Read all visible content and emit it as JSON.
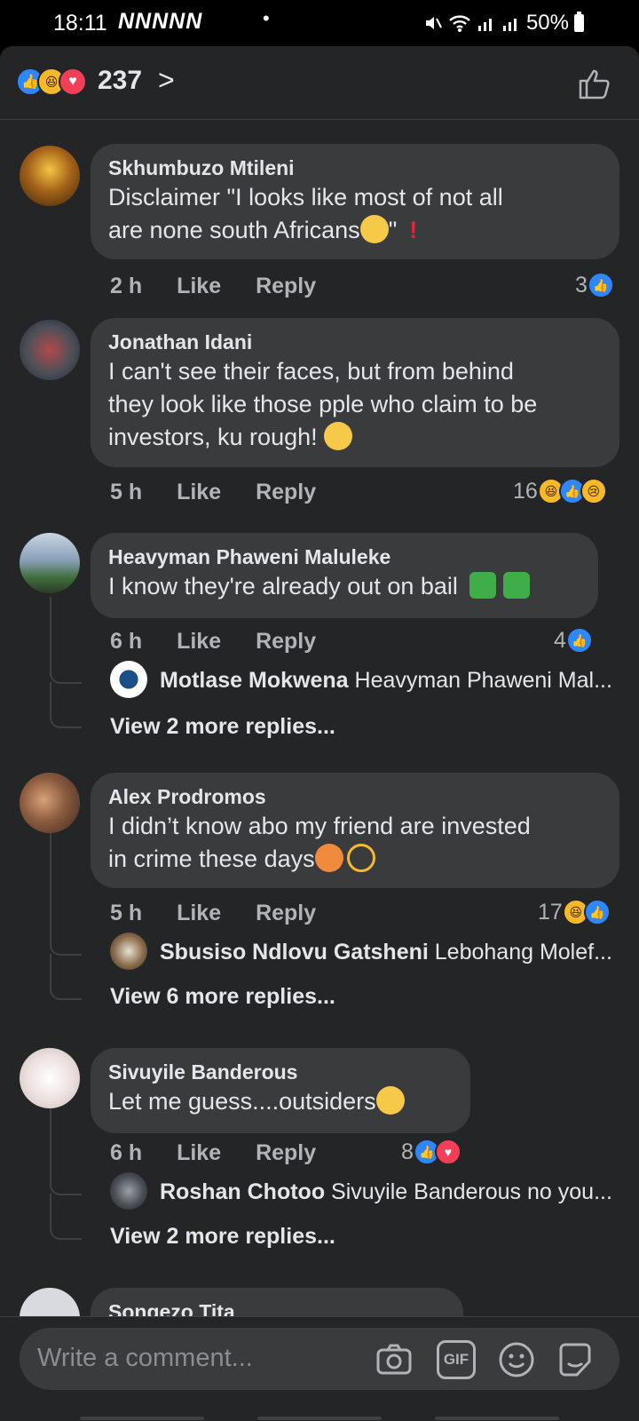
{
  "status_bar": {
    "time": "18:11",
    "notifications": "NNNNN",
    "dot": "•",
    "battery": "50%"
  },
  "header": {
    "reaction_count": "237",
    "reaction_icons": [
      "like-icon",
      "haha-icon",
      "love-icon"
    ]
  },
  "comments": [
    {
      "name": "Skhumbuzo Mtileni",
      "text_line1": "Disclaimer \"I looks like most of not all",
      "text_line2": "are  none south Africans",
      "text_tail": "\"",
      "emoji": "eye-roll-emoji",
      "time": "2 h",
      "like": "Like",
      "reply": "Reply",
      "reaction_count": "3",
      "reactions": [
        "like"
      ]
    },
    {
      "name": "Jonathan Idani",
      "text_line1": "I can't see their faces, but from behind",
      "text_line2": "they look like those pple who claim to be",
      "text_line3": "investors, ku rough!",
      "emoji": "crying-laughing-emoji",
      "time": "5 h",
      "like": "Like",
      "reply": "Reply",
      "reaction_count": "16",
      "reactions": [
        "haha",
        "like",
        "sad"
      ]
    },
    {
      "name": "Heavyman Phaweni Maluleke",
      "text_line1": "I know they're already out on bail",
      "time": "6 h",
      "like": "Like",
      "reply": "Reply",
      "reaction_count": "4",
      "reactions": [
        "like"
      ],
      "reply_preview": {
        "name": "Motlase Mokwena",
        "text": "Heavyman Phaweni Mal..."
      },
      "more_replies": "View 2 more replies..."
    },
    {
      "name": "Alex Prodromos",
      "text_line1": "I didn’t know abo my friend are invested",
      "text_line2": "in crime these days",
      "time": "5 h",
      "like": "Like",
      "reply": "Reply",
      "reaction_count": "17",
      "reactions": [
        "haha",
        "like"
      ],
      "reply_preview": {
        "name": "Sbusiso Ndlovu Gatsheni",
        "text": "Lebohang Molef..."
      },
      "more_replies": "View 6 more replies..."
    },
    {
      "name": "Sivuyile Banderous",
      "text_line1": "Let me guess....outsiders",
      "time": "6 h",
      "like": "Like",
      "reply": "Reply",
      "reaction_count": "8",
      "reactions": [
        "like",
        "love"
      ],
      "reply_preview": {
        "name": "Roshan Chotoo",
        "text": "Sivuyile Banderous no you..."
      },
      "more_replies": "View 2 more replies..."
    },
    {
      "name": "Songezo Tita"
    }
  ],
  "composer": {
    "placeholder": "Write a comment...",
    "gif_label": "GIF"
  }
}
